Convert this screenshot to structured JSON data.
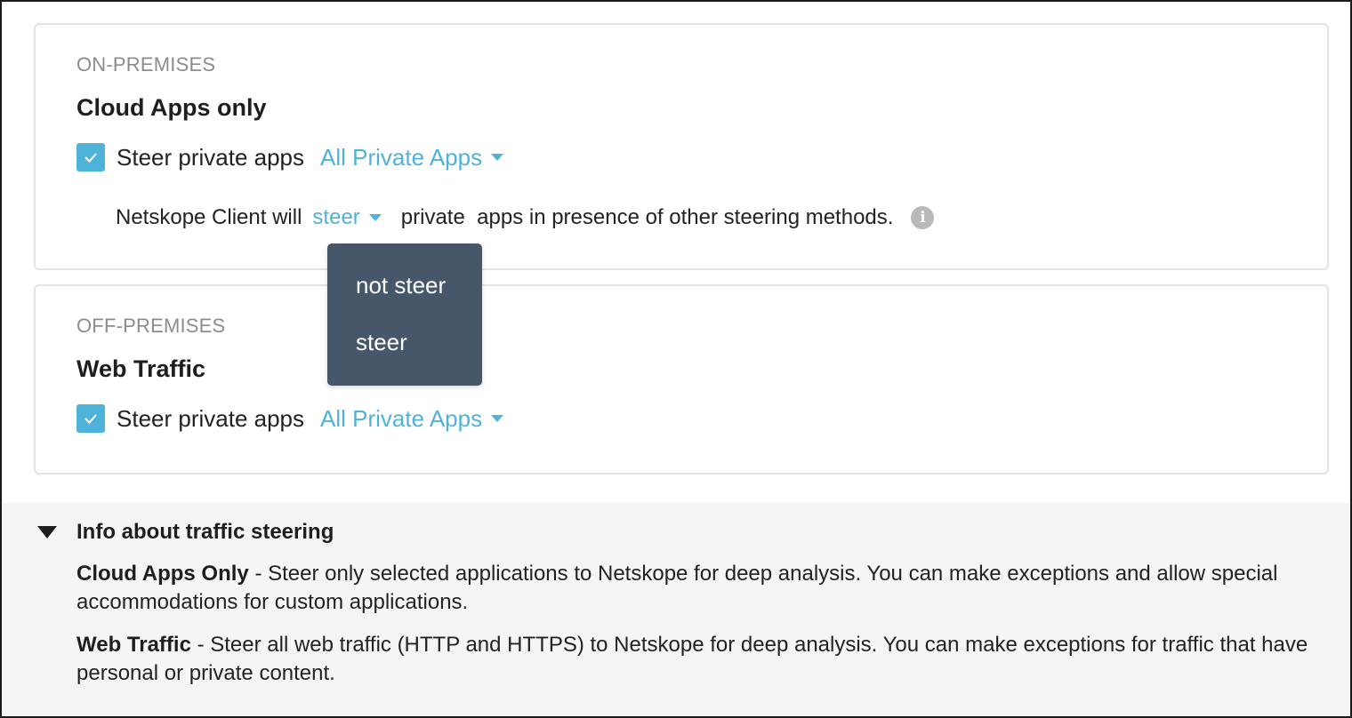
{
  "on_premises": {
    "section_label": "ON-PREMISES",
    "title": "Cloud Apps only",
    "steer_checkbox": {
      "checked": true,
      "label": "Steer private apps"
    },
    "apps_dropdown": "All Private Apps",
    "client_sentence": {
      "prefix": "Netskope Client will",
      "selected": "steer",
      "suffix": "private  apps in presence of other steering methods."
    },
    "steer_options": [
      "not steer",
      "steer"
    ]
  },
  "off_premises": {
    "section_label": "OFF-PREMISES",
    "title": "Web Traffic",
    "steer_checkbox": {
      "checked": true,
      "label": "Steer private apps"
    },
    "apps_dropdown": "All Private Apps"
  },
  "info": {
    "toggle_label": "Info about traffic steering",
    "items": [
      {
        "term": "Cloud Apps Only",
        "desc": " - Steer only selected applications to Netskope for deep analysis. You can make exceptions and allow special accommodations for custom applications."
      },
      {
        "term": "Web Traffic",
        "desc": " - Steer all web traffic (HTTP and HTTPS) to Netskope for deep analysis. You can make exceptions for traffic that have personal or private content."
      }
    ]
  },
  "colors": {
    "accent": "#4fb3d9",
    "menu_bg": "#46576a",
    "panel_bg": "#f5f5f5"
  },
  "icons": {
    "checkbox": "check-icon",
    "info": "info-icon",
    "dropdown": "caret-down-icon",
    "toggle": "triangle-down-icon"
  }
}
